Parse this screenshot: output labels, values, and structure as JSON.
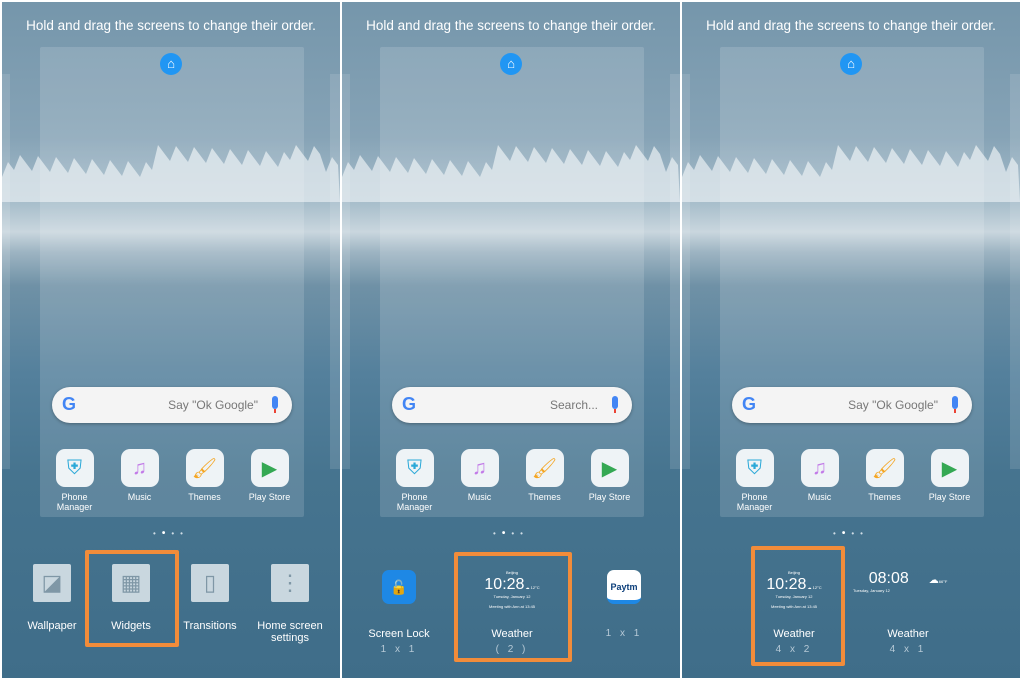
{
  "hint": "Hold and drag the screens to change their order.",
  "search_placeholders": [
    "Say \"Ok Google\"",
    "Search...",
    "Say \"Ok Google\""
  ],
  "apps": [
    {
      "label": "Phone Manager",
      "icon": "shield-icon",
      "color": "#2aa8d8"
    },
    {
      "label": "Music",
      "icon": "music-note-icon",
      "color": "#c27be8"
    },
    {
      "label": "Themes",
      "icon": "paint-brush-icon",
      "color": "#f5a623"
    },
    {
      "label": "Play Store",
      "icon": "play-store-icon",
      "color": "#34a853"
    }
  ],
  "panel1": {
    "menu": [
      {
        "label": "Wallpaper",
        "icon": "wallpaper-icon"
      },
      {
        "label": "Widgets",
        "icon": "widgets-icon",
        "selected": true
      },
      {
        "label": "Transitions",
        "icon": "transitions-icon"
      },
      {
        "label": "Home screen settings",
        "icon": "settings-dots-icon"
      }
    ]
  },
  "panel2": {
    "widgets": [
      {
        "label": "Screen Lock",
        "sub": "1 x 1"
      },
      {
        "label": "Weather",
        "sub": "( 2 )",
        "selected": true
      },
      {
        "label": "",
        "sub": "1 x 1",
        "brand": "Paytm"
      }
    ]
  },
  "panel3": {
    "widgets": [
      {
        "label": "Weather",
        "sub": "4 x 2",
        "selected": true
      },
      {
        "label": "Weather",
        "sub": "4 x 1"
      }
    ]
  },
  "weather_preview": {
    "city": "Beijing",
    "time": "10:28",
    "temp": "12°C",
    "date": "Tuesday, January 12",
    "event": "Meeting with Ann at 13:45",
    "time2": "08:08",
    "temp2": "66°F",
    "date2": "Tuesday, January 12"
  },
  "accent": "#f28c3a"
}
